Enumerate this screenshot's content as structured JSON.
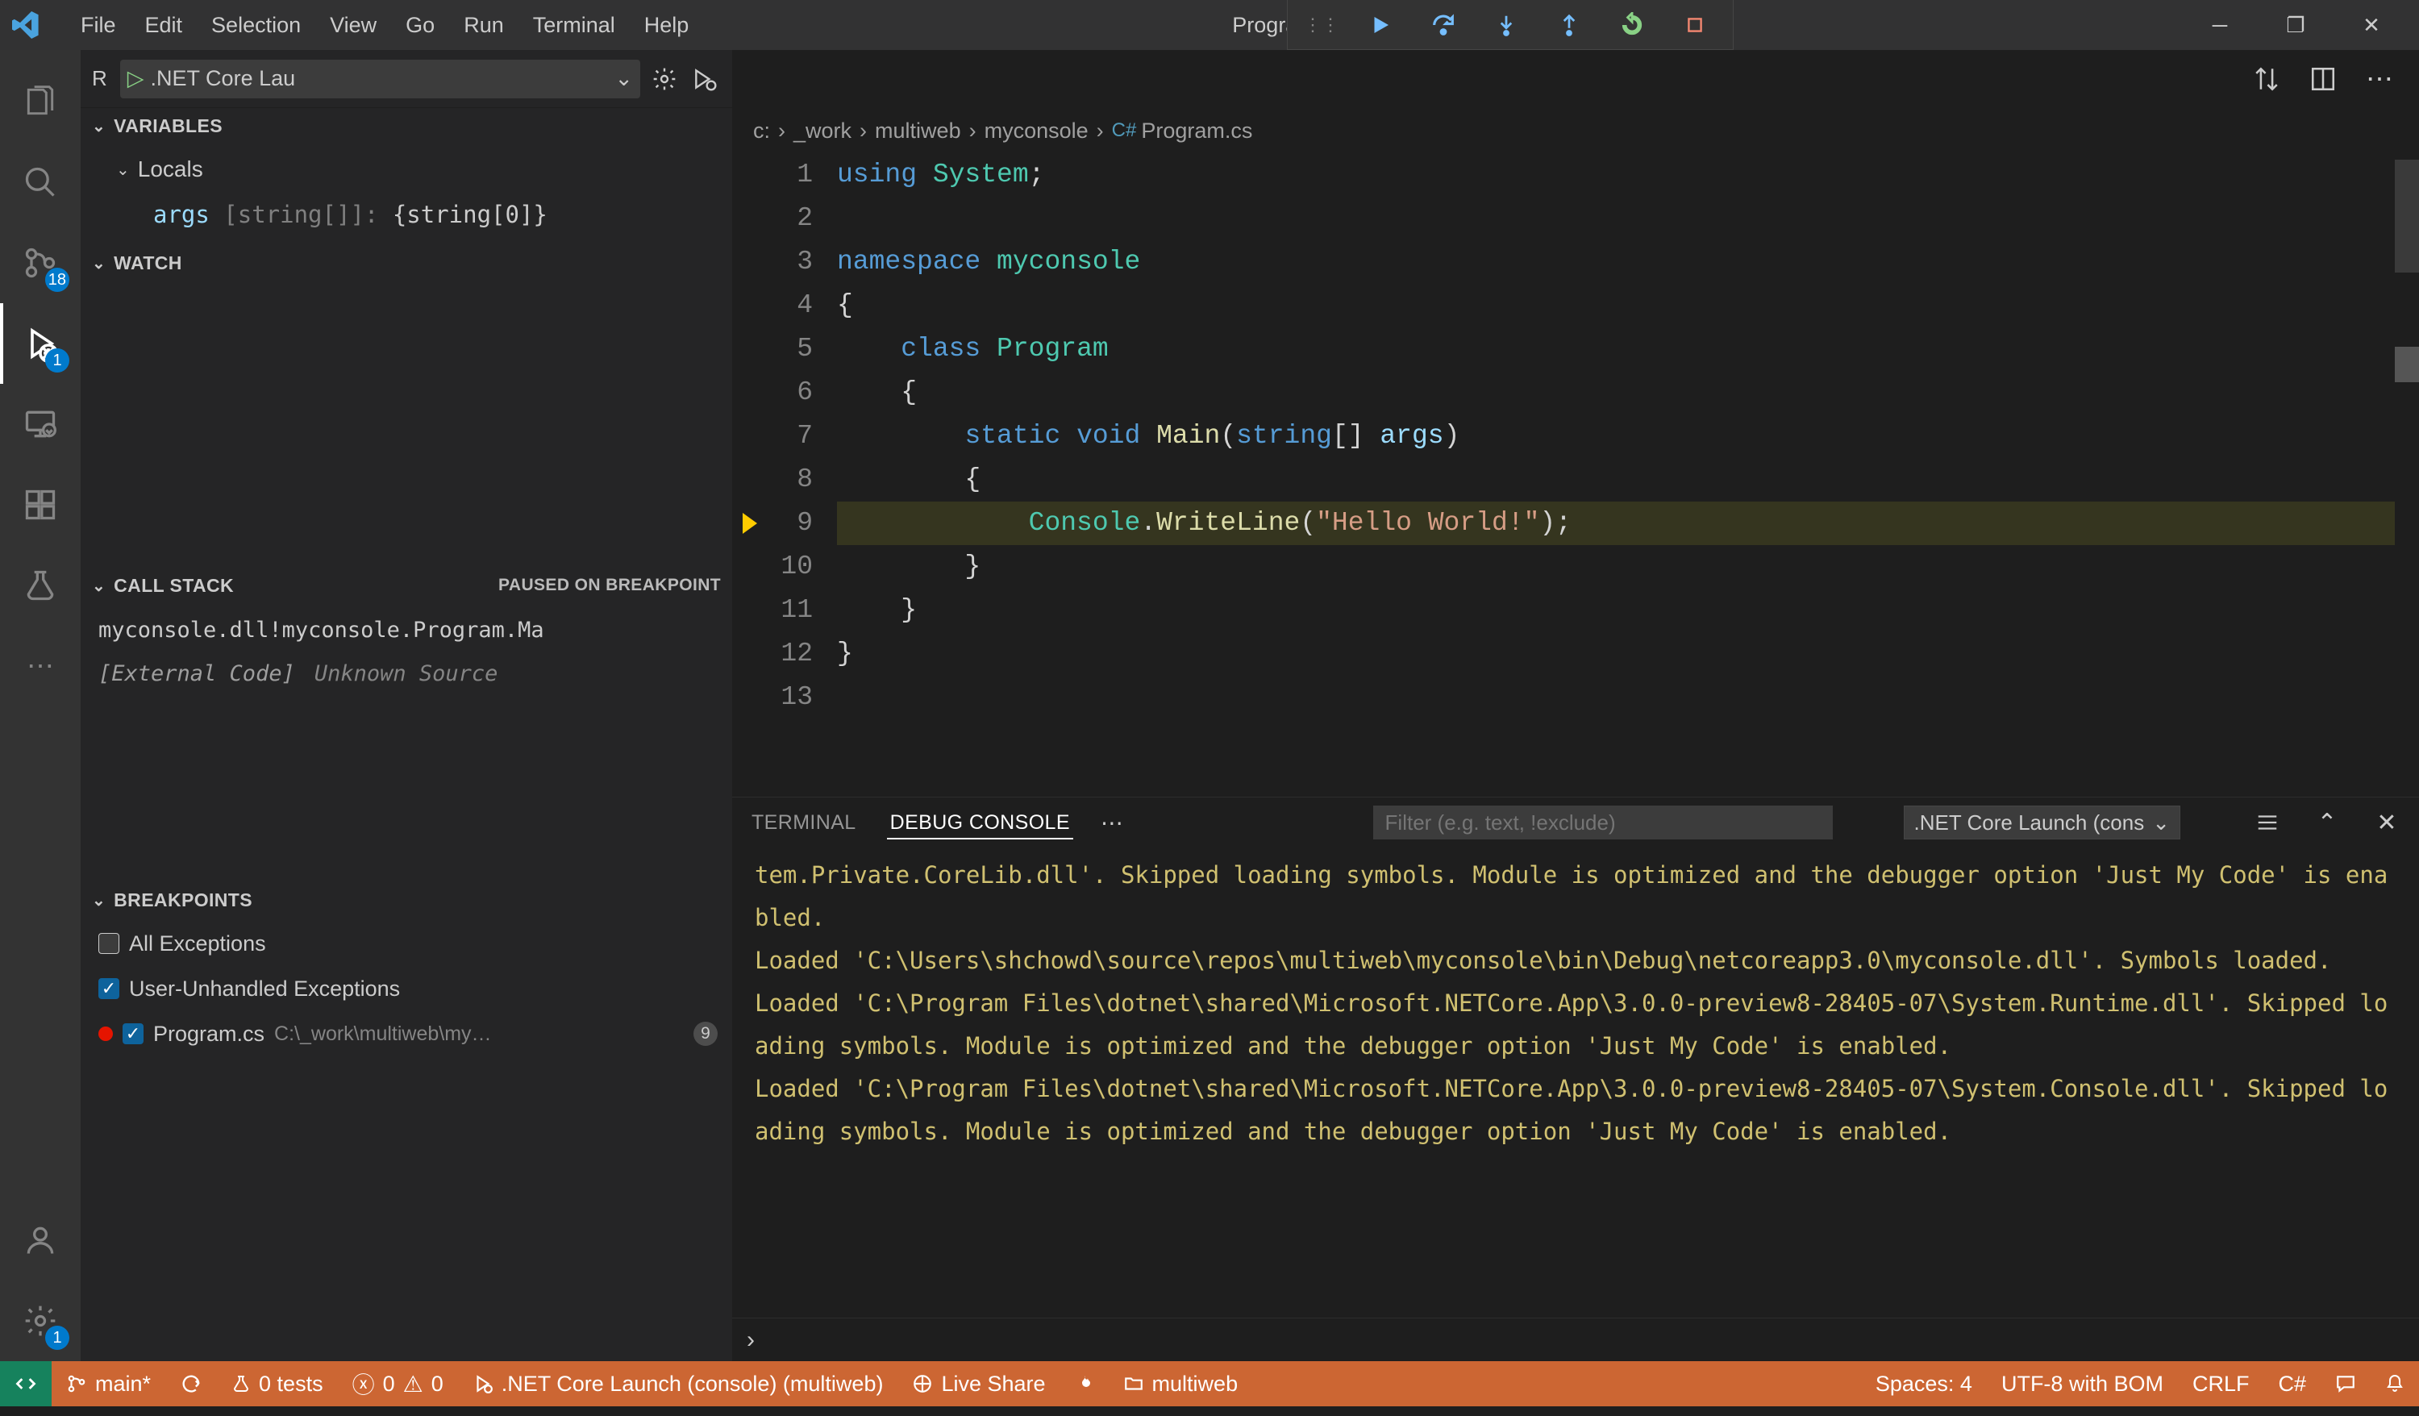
{
  "titlebar": {
    "menu": [
      "File",
      "Edit",
      "Selection",
      "View",
      "Go",
      "Run",
      "Terminal",
      "Help"
    ],
    "title": "Program.cs - multiweb - Visual Studio Code"
  },
  "activitybar": {
    "scm_badge": "18",
    "debug_badge": "1",
    "settings_badge": "1"
  },
  "sidebar": {
    "run_prefix": "R",
    "launch_config": ".NET Core Lau",
    "sections": {
      "variables": {
        "title": "VARIABLES",
        "locals_label": "Locals",
        "var_name": "args",
        "var_type": " [string[]]: ",
        "var_value": "{string[0]}"
      },
      "watch": {
        "title": "WATCH"
      },
      "callstack": {
        "title": "CALL STACK",
        "status": "PAUSED ON BREAKPOINT",
        "rows": [
          {
            "text": "myconsole.dll!myconsole.Program.Ma",
            "ext": false
          },
          {
            "text": "[External Code]",
            "source": "Unknown Source",
            "ext": true
          }
        ]
      },
      "breakpoints": {
        "title": "BREAKPOINTS",
        "items": [
          {
            "checked": false,
            "label": "All Exceptions",
            "dot": false
          },
          {
            "checked": true,
            "label": "User-Unhandled Exceptions",
            "dot": false
          },
          {
            "checked": true,
            "label": "Program.cs",
            "path": "C:\\_work\\multiweb\\my…",
            "count": "9",
            "dot": true
          }
        ]
      }
    }
  },
  "breadcrumbs": [
    "c:",
    "_work",
    "multiweb",
    "myconsole",
    "Program.cs"
  ],
  "editor": {
    "lines": [
      {
        "n": 1,
        "segs": [
          [
            "using ",
            "tok-kw"
          ],
          [
            "System",
            "tok-type"
          ],
          [
            ";",
            "tok-punc"
          ]
        ]
      },
      {
        "n": 2,
        "segs": [
          [
            "",
            "tok-plain"
          ]
        ]
      },
      {
        "n": 3,
        "segs": [
          [
            "namespace ",
            "tok-kw"
          ],
          [
            "myconsole",
            "tok-type"
          ]
        ]
      },
      {
        "n": 4,
        "segs": [
          [
            "{",
            "tok-punc"
          ]
        ]
      },
      {
        "n": 5,
        "segs": [
          [
            "    ",
            "tok-plain"
          ],
          [
            "class ",
            "tok-kw"
          ],
          [
            "Program",
            "tok-type"
          ]
        ]
      },
      {
        "n": 6,
        "segs": [
          [
            "    {",
            "tok-punc"
          ]
        ]
      },
      {
        "n": 7,
        "segs": [
          [
            "        ",
            "tok-plain"
          ],
          [
            "static ",
            "tok-kw"
          ],
          [
            "void ",
            "tok-kw"
          ],
          [
            "Main",
            "tok-method"
          ],
          [
            "(",
            "tok-punc"
          ],
          [
            "string",
            "tok-kw"
          ],
          [
            "[] ",
            "tok-punc"
          ],
          [
            "args",
            "tok-id"
          ],
          [
            ")",
            "tok-punc"
          ]
        ]
      },
      {
        "n": 8,
        "segs": [
          [
            "        {",
            "tok-punc"
          ]
        ]
      },
      {
        "n": 9,
        "hl": true,
        "glyph": "cursor",
        "segs": [
          [
            "            ",
            "tok-plain"
          ],
          [
            "Console",
            "tok-type"
          ],
          [
            ".",
            "tok-punc"
          ],
          [
            "WriteLine",
            "tok-method"
          ],
          [
            "(",
            "tok-punc"
          ],
          [
            "\"Hello World!\"",
            "tok-str"
          ],
          [
            ");",
            "tok-punc"
          ]
        ]
      },
      {
        "n": 10,
        "segs": [
          [
            "        }",
            "tok-punc"
          ]
        ]
      },
      {
        "n": 11,
        "segs": [
          [
            "    }",
            "tok-punc"
          ]
        ]
      },
      {
        "n": 12,
        "segs": [
          [
            "}",
            "tok-punc"
          ]
        ]
      },
      {
        "n": 13,
        "segs": [
          [
            "",
            "tok-plain"
          ]
        ]
      }
    ]
  },
  "panel": {
    "tabs": {
      "terminal": "TERMINAL",
      "debug": "DEBUG CONSOLE"
    },
    "filter_placeholder": "Filter (e.g. text, !exclude)",
    "scope": ".NET Core Launch (cons",
    "console": [
      "tem.Private.CoreLib.dll'. Skipped loading symbols. Module is optimized and the debugger option 'Just My Code' is enabled.",
      "Loaded 'C:\\Users\\shchowd\\source\\repos\\multiweb\\myconsole\\bin\\Debug\\netcoreapp3.0\\myconsole.dll'. Symbols loaded.",
      "Loaded 'C:\\Program Files\\dotnet\\shared\\Microsoft.NETCore.App\\3.0.0-preview8-28405-07\\System.Runtime.dll'. Skipped loading symbols. Module is optimized and the debugger option 'Just My Code' is enabled.",
      "Loaded 'C:\\Program Files\\dotnet\\shared\\Microsoft.NETCore.App\\3.0.0-preview8-28405-07\\System.Console.dll'. Skipped loading symbols. Module is optimized and the debugger option 'Just My Code' is enabled."
    ]
  },
  "statusbar": {
    "remote_icon": "⇄",
    "branch": "main*",
    "tests": "0 tests",
    "errors": "0",
    "warnings": "0",
    "debug_config": ".NET Core Launch (console) (multiweb)",
    "liveshare": "Live Share",
    "folder": "multiweb",
    "spaces": "Spaces: 4",
    "encoding": "UTF-8 with BOM",
    "eol": "CRLF",
    "lang": "C#"
  }
}
